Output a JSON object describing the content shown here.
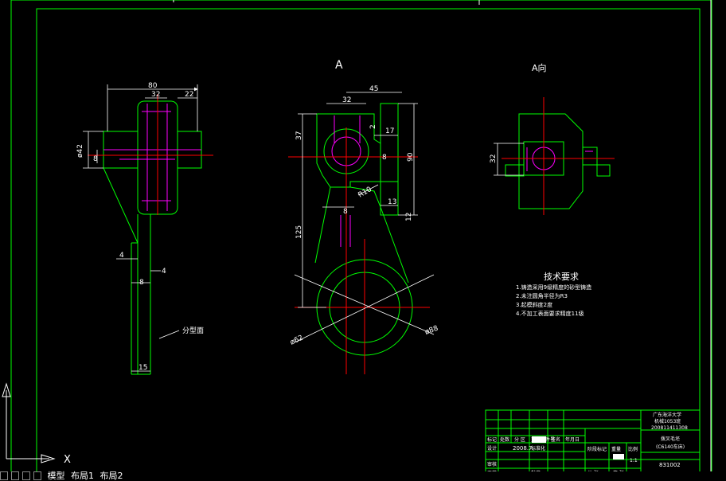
{
  "colors": {
    "background": "#000000",
    "outline": "#00ff00",
    "dimension": "#ffffff",
    "centerline": "#ff0000",
    "hidden": "#ff00ff",
    "frame": "#00ff00"
  },
  "views": {
    "section_mark": "A",
    "view_a_title": "A向",
    "parting_surface": "分型面"
  },
  "dims": {
    "left_top_80": "80",
    "left_top_32": "32",
    "left_top_22": "22",
    "left_phi42": "ø42",
    "left_8": "8",
    "left_4a": "4",
    "left_4b": "4",
    "left_8b": "8",
    "left_15": "15",
    "mid_45": "45",
    "mid_32": "32",
    "mid_37": "37",
    "mid_2": "2",
    "mid_17": "17",
    "mid_8": "8",
    "mid_90": "90",
    "mid_r10": "R10",
    "mid_13": "13",
    "mid_8b": "8",
    "mid_12": "12",
    "mid_125": "125",
    "mid_phi62": "ø62",
    "mid_phi88": "ø88",
    "right_32": "32"
  },
  "notes": {
    "title": "技术要求",
    "items": [
      "1.铸造采用9级精度的砂型铸造",
      "2.未注圆角半径为R3",
      "3.起模斜度2度",
      "4.不加工表面要求精度11级"
    ]
  },
  "titleblock": {
    "school_1": "广东海洋大学",
    "school_2": "机械1053班",
    "school_3": "200811411308",
    "part_1": "拨叉毛坯",
    "part_2": "(C6140车床)",
    "drawing_no": "831002",
    "designer_date": "2008.7.",
    "row_labels": [
      "标记",
      "处数",
      "分 区",
      "更改文件号",
      "签名",
      "年月日"
    ],
    "design_label": "设计",
    "standard_label": "标准化",
    "check_label": "审核",
    "process_label": "工艺",
    "approve_label": "批准",
    "stage_label": "阶段标记",
    "weight_label": "重量",
    "scale_label": "比例",
    "scale_value": "1:1",
    "sheet_total": "共 张",
    "sheet_no": "第 张"
  },
  "ucs": {
    "x_label": "X",
    "y_label": "Y"
  },
  "tabs": {
    "model": "模型",
    "layout1": "布局1",
    "layout2": "布局2"
  }
}
